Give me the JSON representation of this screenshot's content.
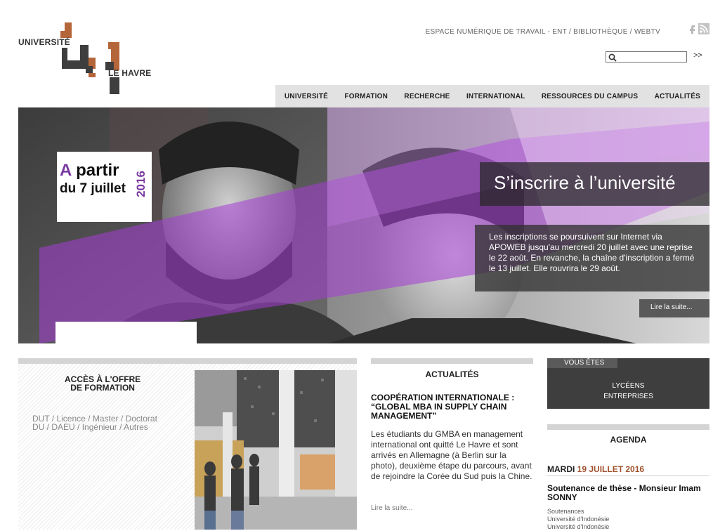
{
  "logo": {
    "line1": "UNIVERSITÉ",
    "line2": "LE HAVRE"
  },
  "toplinks": {
    "ent": "ESPACE NUMÉRIQUE DE TRAVAIL - ENT",
    "sep1": " / ",
    "library": "BIBLIOTHÈQUE",
    "sep2": " / ",
    "webtv": "WEBTV"
  },
  "search": {
    "placeholder": "",
    "go": ">>"
  },
  "nav": [
    "UNIVERSITÉ",
    "FORMATION",
    "RECHERCHE",
    "INTERNATIONAL",
    "RESSOURCES DU CAMPUS",
    "ACTUALITÉS"
  ],
  "hero": {
    "date_a": "A",
    "date_partir": " partir",
    "date_line2": "du 7 juillet",
    "date_year": "2016",
    "title": "S’inscrire à l’université",
    "text": "Les inscriptions se poursuivent sur Internet via APOWEB jusqu'au mercredi 20 juillet avec une reprise le 22 août. En revanche, la chaîne d'inscription a fermé le 13 juillet. Elle rouvrira le 29 août.",
    "more": "Lire la suite..."
  },
  "offer": {
    "title1": "ACCÈS À L'OFFRE",
    "title2": "DE FORMATION",
    "links1": [
      "DUT",
      "Licence",
      "Master",
      "Doctorat"
    ],
    "links2": [
      "DU",
      "DAEU",
      "Ingénieur",
      "Autres"
    ]
  },
  "news": {
    "heading": "ACTUALITÉS",
    "title": "COOPÉRATION INTERNATIONALE : “GLOBAL MBA IN SUPPLY CHAIN MANAGEMENT”",
    "text": "Les étudiants du GMBA en management international ont quitté Le Havre et sont arrivés en Allemagne (à Berlin sur la photo), deuxième étape du parcours, avant de rejoindre la Corée du Sud puis la Chine.",
    "more": "Lire la suite..."
  },
  "vous": {
    "tab": "VOUS ÊTES",
    "items": [
      "LYCÉENS",
      "ENTREPRISES"
    ]
  },
  "agenda": {
    "heading": "AGENDA",
    "day": "MARDI",
    "date": "19 JUILLET 2016",
    "title": "Soutenance de thèse - Monsieur Imam SONNY",
    "sub1": "Soutenances",
    "sub2": "Université d'Indonésie",
    "sub3": "Université d'Indonésie"
  },
  "colors": {
    "accent_purple": "#7a3aa0",
    "brand_orange": "#b5653a",
    "dark_gray": "#3e3e3e"
  },
  "icons": [
    "facebook-icon",
    "rss-icon",
    "search-icon"
  ]
}
